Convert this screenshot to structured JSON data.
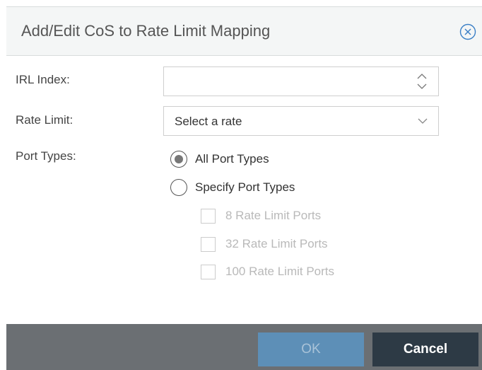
{
  "dialog": {
    "title": "Add/Edit CoS to Rate Limit Mapping",
    "close_icon": "close-circle-icon"
  },
  "form": {
    "irl_index": {
      "label": "IRL Index:",
      "value": "",
      "placeholder": ""
    },
    "rate_limit": {
      "label": "Rate Limit:",
      "selected": "Select a rate"
    },
    "port_types": {
      "label": "Port Types:",
      "options": [
        {
          "label": "All Port Types",
          "checked": true
        },
        {
          "label": "Specify Port Types",
          "checked": false
        }
      ],
      "specific": [
        {
          "label": "8 Rate Limit Ports",
          "checked": false,
          "disabled": true
        },
        {
          "label": "32 Rate Limit Ports",
          "checked": false,
          "disabled": true
        },
        {
          "label": "100 Rate Limit Ports",
          "checked": false,
          "disabled": true
        }
      ]
    }
  },
  "footer": {
    "ok_label": "OK",
    "cancel_label": "Cancel",
    "ok_disabled": true
  },
  "colors": {
    "titlebar_bg": "#f4f6f6",
    "footer_bg": "#6b6f73",
    "ok_bg": "#5d8fb7",
    "cancel_bg": "#2d3a45",
    "close_icon_color": "#3a7fc6"
  }
}
